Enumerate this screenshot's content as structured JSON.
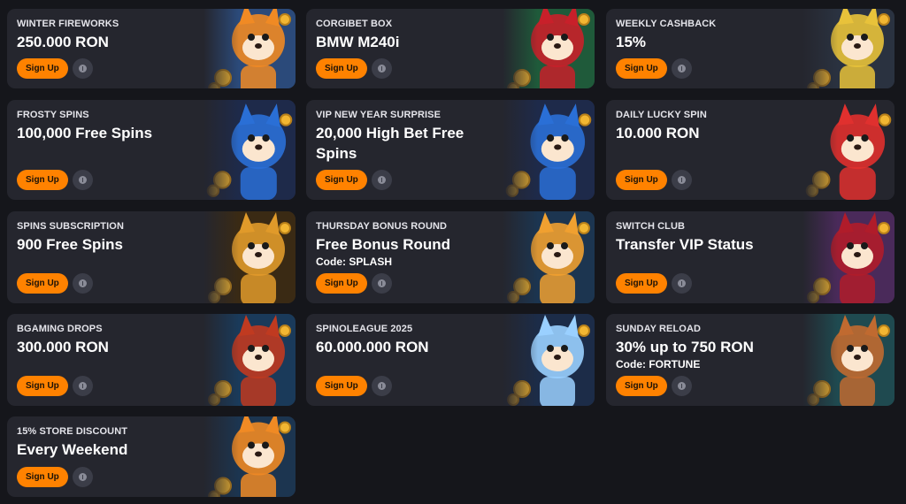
{
  "promos": [
    {
      "label": "WINTER FIREWORKS",
      "title": "250.000 RON",
      "code": "",
      "button": "Sign Up",
      "icon": "fox-fireworks-icon",
      "art_color": "#2b4a7a",
      "accent": "#f08a24"
    },
    {
      "label": "CORGIBET BOX",
      "title": "BMW M240i",
      "code": "",
      "button": "Sign Up",
      "icon": "gift-box-icon",
      "art_color": "#1f5a3a",
      "accent": "#c8202a"
    },
    {
      "label": "WEEKLY CASHBACK",
      "title": "15%",
      "code": "",
      "button": "Sign Up",
      "icon": "cashback-house-icon",
      "art_color": "#2a3240",
      "accent": "#e8c23a"
    },
    {
      "label": "FROSTY SPINS",
      "title": "100,000 Free Spins",
      "code": "",
      "button": "Sign Up",
      "icon": "jester-corgi-icon",
      "art_color": "#1e2a4a",
      "accent": "#2a6fd6"
    },
    {
      "label": "VIP NEW YEAR SURPRISE",
      "title": "20,000 High Bet Free Spins",
      "code": "",
      "button": "Sign Up",
      "icon": "jester-corgi-icon",
      "art_color": "#1e2a4a",
      "accent": "#2a6fd6"
    },
    {
      "label": "DAILY LUCKY SPIN",
      "title": "10.000 RON",
      "code": "",
      "button": "Sign Up",
      "icon": "corgi-sunglasses-icon",
      "art_color": "#25262e",
      "accent": "#e0302e"
    },
    {
      "label": "SPINS SUBSCRIPTION",
      "title": "900 Free Spins",
      "code": "",
      "button": "Sign Up",
      "icon": "roman-corgi-icon",
      "art_color": "#3a2a14",
      "accent": "#e09a2a"
    },
    {
      "label": "THURSDAY BONUS ROUND",
      "title": "Free Bonus Round",
      "code": "Code: SPLASH",
      "button": "Sign Up",
      "icon": "corgi-coins-icon",
      "art_color": "#1c3550",
      "accent": "#f0a030"
    },
    {
      "label": "SWITCH CLUB",
      "title": "Transfer VIP Status",
      "code": "",
      "button": "Sign Up",
      "icon": "king-corgi-icon",
      "art_color": "#4a2a5a",
      "accent": "#b01c2a"
    },
    {
      "label": "BGAMING DROPS",
      "title": "300.000 RON",
      "code": "",
      "button": "Sign Up",
      "icon": "cowgirl-corgi-icon",
      "art_color": "#1a3a5a",
      "accent": "#c03a20"
    },
    {
      "label": "SPINOLEAGUE 2025",
      "title": "60.000.000 RON",
      "code": "",
      "button": "Sign Up",
      "icon": "zeus-icon",
      "art_color": "#1c2c48",
      "accent": "#9ad0ff"
    },
    {
      "label": "SUNDAY RELOAD",
      "title": "30% up to 750 RON",
      "code": "Code: FORTUNE",
      "button": "Sign Up",
      "icon": "paw-medallion-icon",
      "art_color": "#1f4a50",
      "accent": "#c06a30"
    },
    {
      "label": "15% STORE DISCOUNT",
      "title": "Every Weekend",
      "code": "",
      "button": "Sign Up",
      "icon": "percent-corgi-icon",
      "art_color": "#1c3550",
      "accent": "#f08a24"
    }
  ]
}
